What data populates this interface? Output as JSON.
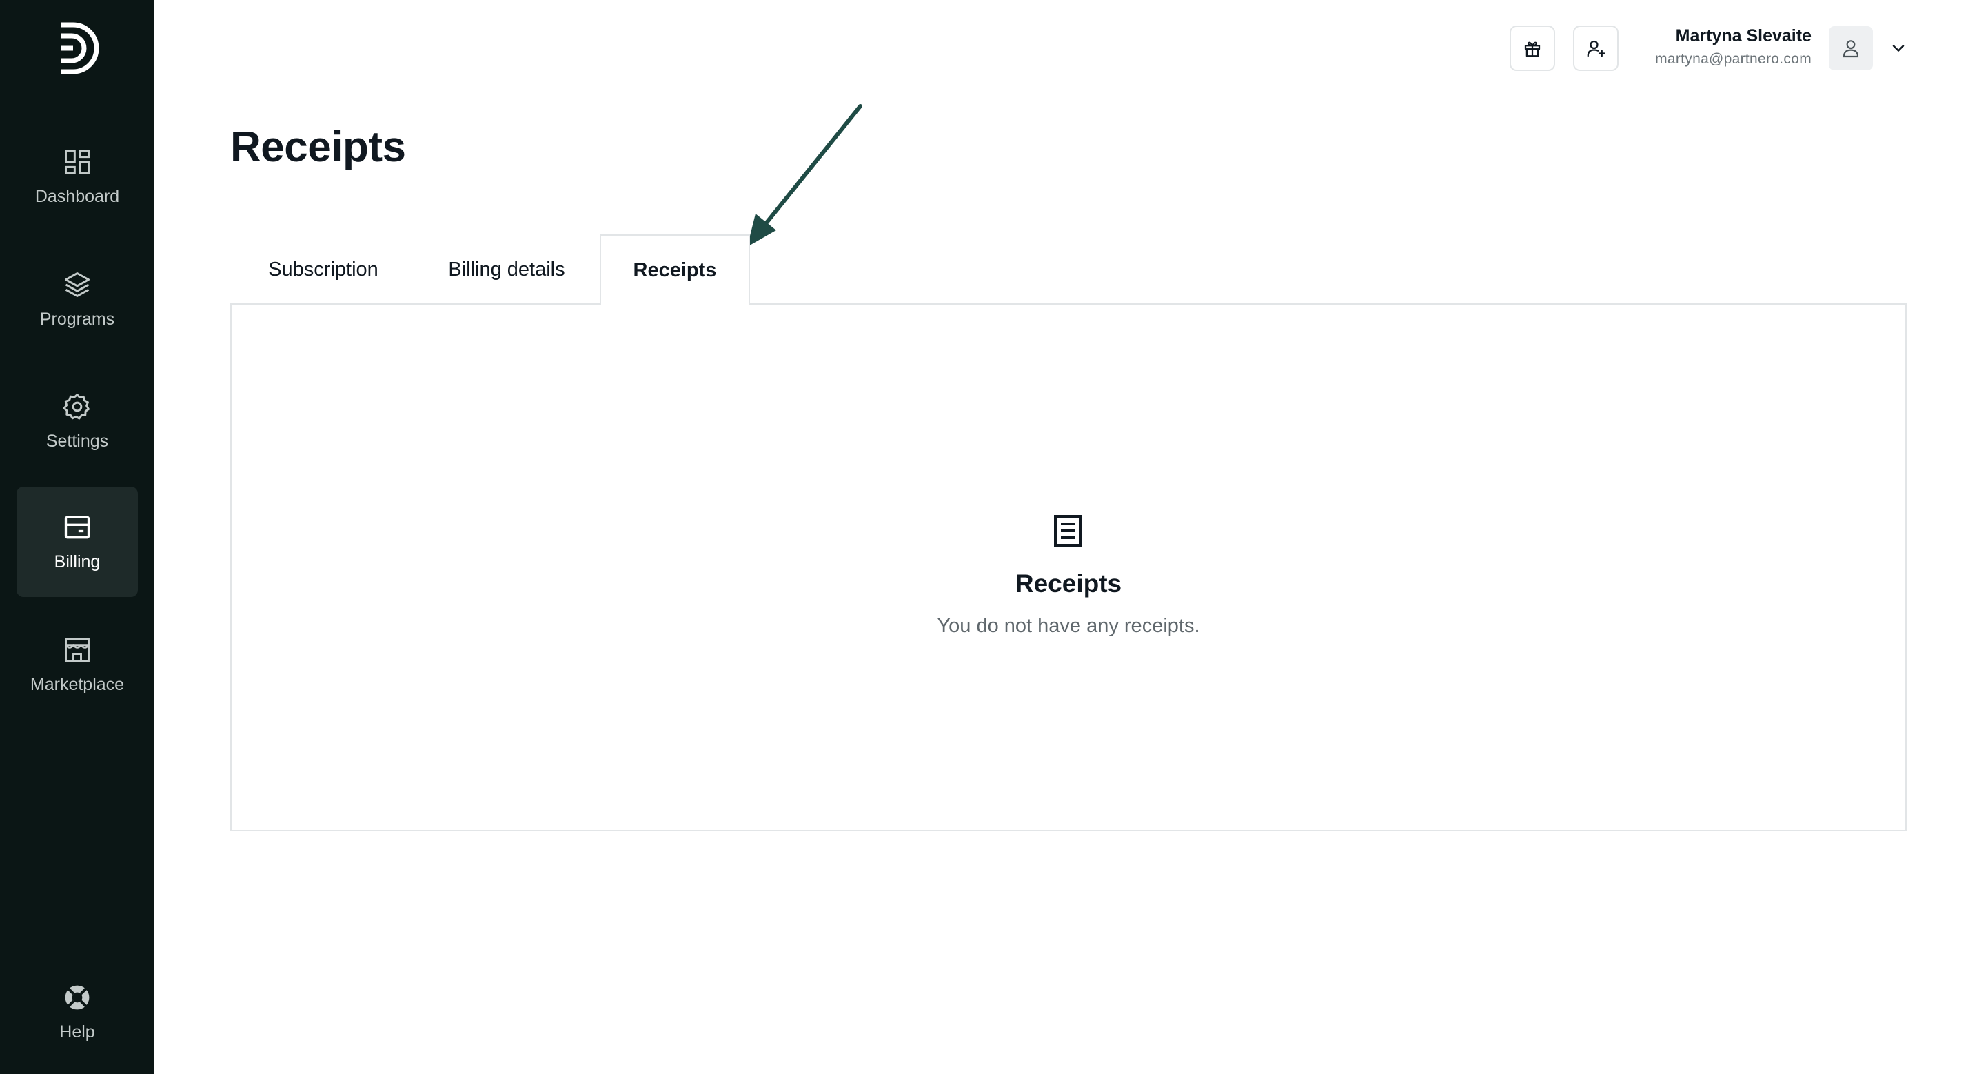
{
  "sidebar": {
    "items": [
      {
        "label": "Dashboard",
        "icon": "dashboard-icon"
      },
      {
        "label": "Programs",
        "icon": "layers-icon"
      },
      {
        "label": "Settings",
        "icon": "gear-icon"
      },
      {
        "label": "Billing",
        "icon": "credit-card-icon",
        "active": true
      },
      {
        "label": "Marketplace",
        "icon": "store-icon"
      }
    ],
    "help": {
      "label": "Help",
      "icon": "lifebuoy-icon"
    }
  },
  "header": {
    "user_name": "Martyna Slevaite",
    "user_email": "martyna@partnero.com"
  },
  "page": {
    "title": "Receipts",
    "tabs": [
      {
        "label": "Subscription"
      },
      {
        "label": "Billing details"
      },
      {
        "label": "Receipts",
        "active": true
      }
    ]
  },
  "empty_state": {
    "title": "Receipts",
    "message": "You do not have any receipts."
  },
  "colors": {
    "sidebar_bg": "#0b1615",
    "sidebar_active_bg": "#1e2a29",
    "arrow": "#1f4b45"
  }
}
